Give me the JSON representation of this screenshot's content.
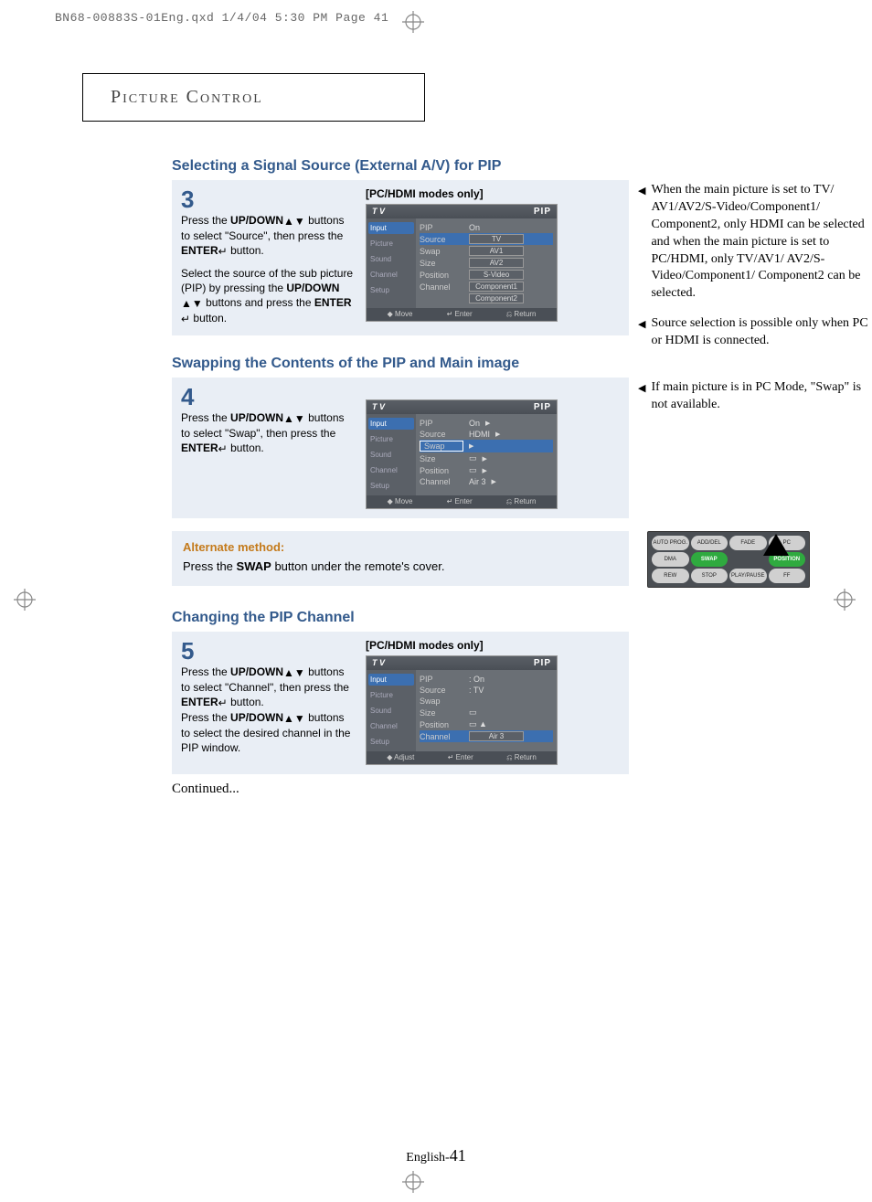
{
  "print_header": "BN68-00883S-01Eng.qxd  1/4/04 5:30 PM  Page 41",
  "chapter_title": "Picture Control",
  "page_number_prefix": "English-",
  "page_number": "41",
  "continued": "Continued...",
  "section3": {
    "title": "Selecting a Signal Source (External A/V) for PIP",
    "step_num": "3",
    "instr_a": "Press the ",
    "instr_b": "UP/DOWN",
    "instr_c": " buttons to select \"Source\", then press the ",
    "instr_d": "ENTER",
    "instr_e": " button.",
    "instr2": "Select the source of the sub picture (PIP) by pressing the ",
    "instr2b": "UP/DOWN",
    "instr2c": " buttons and press the ",
    "instr2d": "ENTER",
    "instr2e": "  button.",
    "modes_only": "[PC/HDMI modes only]",
    "osd": {
      "title_left": "T V",
      "title_right": "PIP",
      "sidebar": [
        "Input",
        "Picture",
        "Sound",
        "Channel",
        "Setup"
      ],
      "rows": [
        {
          "lab": "PIP",
          "val": "On"
        },
        {
          "lab": "Source",
          "valbox": "TV"
        },
        {
          "lab": "Swap",
          "valbox": "AV1"
        },
        {
          "lab": "Size",
          "valbox": "AV2"
        },
        {
          "lab": "Position",
          "valbox": "S-Video"
        },
        {
          "lab": "Channel",
          "valbox": "Component1"
        },
        {
          "lab": "",
          "valbox": "Component2"
        }
      ],
      "footer": [
        "◆ Move",
        "↵ Enter",
        "⎌ Return"
      ]
    },
    "notes": [
      "When the main picture is set to TV/ AV1/AV2/S-Video/Component1/ Component2, only HDMI can be selected and when the main picture is set to PC/HDMI, only TV/AV1/ AV2/S-Video/Component1/ Component2 can be selected.",
      "Source selection is possible only when PC or HDMI is connected."
    ]
  },
  "section4": {
    "title": "Swapping the Contents of the PIP and Main image",
    "step_num": "4",
    "instr_a": "Press the ",
    "instr_b": "UP/DOWN",
    "instr_c": " buttons to select \"Swap\", then press the ",
    "instr_d": "ENTER",
    "instr_e": " button.",
    "osd": {
      "title_left": "T V",
      "title_right": "PIP",
      "sidebar": [
        "Input",
        "Picture",
        "Sound",
        "Channel",
        "Setup"
      ],
      "rows": [
        {
          "lab": "PIP",
          "val": "On"
        },
        {
          "lab": "Source",
          "val": "HDMI"
        },
        {
          "lab": "Swap",
          "hl": true
        },
        {
          "lab": "Size",
          "icon": "▭"
        },
        {
          "lab": "Position",
          "icon": "▭"
        },
        {
          "lab": "Channel",
          "val": "Air   3"
        }
      ],
      "footer": [
        "◆ Move",
        "↵ Enter",
        "⎌ Return"
      ]
    },
    "notes": [
      "If main picture is in PC Mode, \"Swap\" is not available."
    ],
    "alt_title": "Alternate method:",
    "alt_body_a": "Press the ",
    "alt_body_b": "SWAP",
    "alt_body_c": " button under the remote's cover.",
    "remote_buttons": [
      "AUTO PROG.",
      "ADD/DEL",
      "FADE",
      "PC",
      "DMA",
      "SWAP",
      "",
      "POSITION",
      "REW",
      "STOP",
      "PLAY/PAUSE",
      "FF"
    ]
  },
  "section5": {
    "title": "Changing the PIP Channel",
    "step_num": "5",
    "instr_a": "Press the ",
    "instr_b": "UP/DOWN",
    "instr_c": " buttons to select \"Channel\", then press the ",
    "instr_d": "ENTER",
    "instr_e": " button.",
    "instr2a": "Press the ",
    "instr2b": "UP/DOWN",
    "instr2c": " buttons to select the desired channel in the PIP window.",
    "modes_only": "[PC/HDMI modes only]",
    "osd": {
      "title_left": "T V",
      "title_right": "PIP",
      "sidebar": [
        "Input",
        "Picture",
        "Sound",
        "Channel",
        "Setup"
      ],
      "rows": [
        {
          "lab": "PIP",
          "val": ": On"
        },
        {
          "lab": "Source",
          "val": ": TV"
        },
        {
          "lab": "Swap",
          "val": ""
        },
        {
          "lab": "Size",
          "icon": "▭"
        },
        {
          "lab": "Position",
          "icon": "▭"
        },
        {
          "lab": "Channel",
          "valbox": "Air   3",
          "hl": true
        }
      ],
      "footer": [
        "◆ Adjust",
        "↵ Enter",
        "⎌ Return"
      ]
    }
  }
}
